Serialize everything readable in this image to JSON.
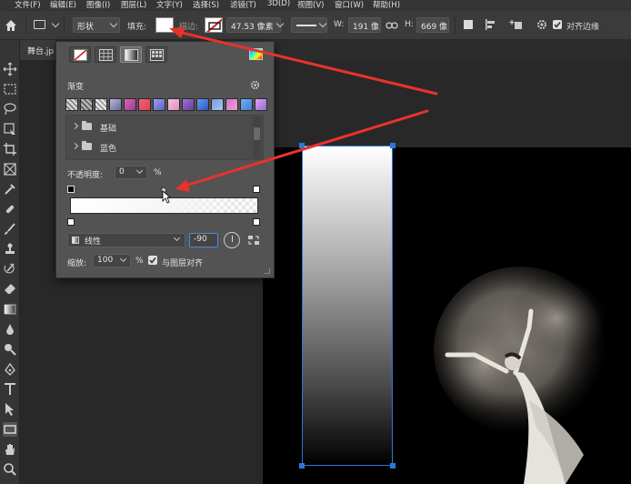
{
  "menu": {
    "items": [
      "文件(F)",
      "编辑(E)",
      "图像(I)",
      "图层(L)",
      "文字(Y)",
      "选择(S)",
      "滤镜(T)",
      "3D(D)",
      "视图(V)",
      "窗口(W)",
      "帮助(H)"
    ]
  },
  "options_bar": {
    "shape_mode": "形状",
    "fill_label": "填充:",
    "stroke_label": "描边:",
    "stroke_width": "47.53 像素",
    "w_label": "W:",
    "w_value": "191 像",
    "h_label": "H:",
    "h_value": "669 像",
    "align_edges_label": "对齐边缘"
  },
  "document": {
    "tab_title": "舞台.jp"
  },
  "gradient_panel": {
    "section_title": "渐变",
    "folders": [
      "基础",
      "蓝色"
    ],
    "opacity_label": "不透明度:",
    "opacity_value": "0",
    "percent_sign": "%",
    "gradient_type": "线性",
    "angle_value": "-90",
    "scale_label": "缩放:",
    "scale_value": "100",
    "scale_percent": "%",
    "align_with_layer_label": "与图层对齐"
  },
  "colors": {
    "selection_blue": "#2c78d8",
    "annotation_red": "#e8332a",
    "ui_dark": "#353535",
    "panel_gray": "#535353"
  }
}
